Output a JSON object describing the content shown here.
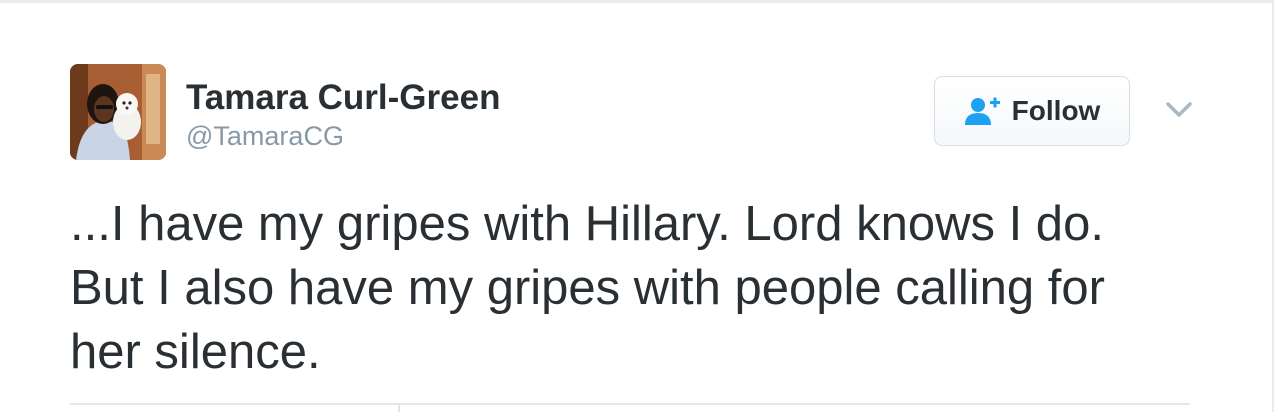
{
  "tweet": {
    "author": {
      "display_name": "Tamara Curl-Green",
      "handle": "@TamaraCG",
      "avatar_icon": "profile-photo"
    },
    "follow_button": {
      "label": "Follow",
      "icon": "follow-person-icon",
      "icon_color": "#1da1f2"
    },
    "more_menu_icon": "chevron-down-icon",
    "text_lines": [
      "...I have my gripes with Hillary. Lord knows I do.",
      "But I also have my gripes with people calling for",
      "her silence."
    ]
  },
  "colors": {
    "text": "#292f33",
    "secondary_text": "#8899a6",
    "accent": "#1da1f2",
    "border": "#e1e8ed"
  }
}
